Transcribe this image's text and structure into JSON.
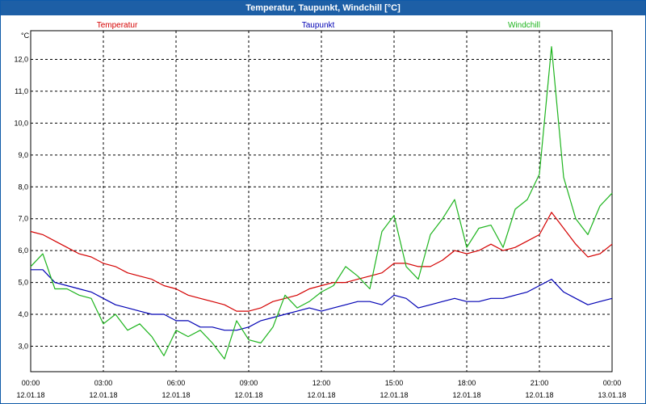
{
  "window": {
    "title": "Temperatur, Taupunkt, Windchill [°C]"
  },
  "chart_data": {
    "type": "line",
    "title": "Temperatur, Taupunkt, Windchill [°C]",
    "ylabel": "°C",
    "ylim": [
      2.2,
      12.9
    ],
    "xlim": [
      "2018-01-12 00:00",
      "2018-01-13 00:00"
    ],
    "yticks": [
      "3,0",
      "4,0",
      "5,0",
      "6,0",
      "7,0",
      "8,0",
      "9,0",
      "10,0",
      "11,0",
      "12,0"
    ],
    "xticks": [
      {
        "time": "00:00",
        "date": "12.01.18"
      },
      {
        "time": "03:00",
        "date": "12.01.18"
      },
      {
        "time": "06:00",
        "date": "12.01.18"
      },
      {
        "time": "09:00",
        "date": "12.01.18"
      },
      {
        "time": "12:00",
        "date": "12.01.18"
      },
      {
        "time": "15:00",
        "date": "12.01.18"
      },
      {
        "time": "18:00",
        "date": "12.01.18"
      },
      {
        "time": "21:00",
        "date": "12.01.18"
      },
      {
        "time": "00:00",
        "date": "13.01.18"
      }
    ],
    "grid": true,
    "legend_placement": "top",
    "series": [
      {
        "name": "Temperatur",
        "color": "#d40000",
        "points": [
          [
            "2018-01-12 00:00",
            6.6
          ],
          [
            "2018-01-12 00:30",
            6.5
          ],
          [
            "2018-01-12 01:00",
            6.3
          ],
          [
            "2018-01-12 01:30",
            6.1
          ],
          [
            "2018-01-12 02:00",
            5.9
          ],
          [
            "2018-01-12 02:30",
            5.8
          ],
          [
            "2018-01-12 03:00",
            5.6
          ],
          [
            "2018-01-12 03:30",
            5.5
          ],
          [
            "2018-01-12 04:00",
            5.3
          ],
          [
            "2018-01-12 04:30",
            5.2
          ],
          [
            "2018-01-12 05:00",
            5.1
          ],
          [
            "2018-01-12 05:30",
            4.9
          ],
          [
            "2018-01-12 06:00",
            4.8
          ],
          [
            "2018-01-12 06:30",
            4.6
          ],
          [
            "2018-01-12 07:00",
            4.5
          ],
          [
            "2018-01-12 07:30",
            4.4
          ],
          [
            "2018-01-12 08:00",
            4.3
          ],
          [
            "2018-01-12 08:30",
            4.1
          ],
          [
            "2018-01-12 09:00",
            4.1
          ],
          [
            "2018-01-12 09:30",
            4.2
          ],
          [
            "2018-01-12 10:00",
            4.4
          ],
          [
            "2018-01-12 10:30",
            4.5
          ],
          [
            "2018-01-12 11:00",
            4.6
          ],
          [
            "2018-01-12 11:30",
            4.8
          ],
          [
            "2018-01-12 12:00",
            4.9
          ],
          [
            "2018-01-12 12:30",
            5.0
          ],
          [
            "2018-01-12 13:00",
            5.0
          ],
          [
            "2018-01-12 13:30",
            5.1
          ],
          [
            "2018-01-12 14:00",
            5.2
          ],
          [
            "2018-01-12 14:30",
            5.3
          ],
          [
            "2018-01-12 15:00",
            5.6
          ],
          [
            "2018-01-12 15:30",
            5.6
          ],
          [
            "2018-01-12 16:00",
            5.5
          ],
          [
            "2018-01-12 16:30",
            5.5
          ],
          [
            "2018-01-12 17:00",
            5.7
          ],
          [
            "2018-01-12 17:30",
            6.0
          ],
          [
            "2018-01-12 18:00",
            5.9
          ],
          [
            "2018-01-12 18:30",
            6.0
          ],
          [
            "2018-01-12 19:00",
            6.2
          ],
          [
            "2018-01-12 19:30",
            6.0
          ],
          [
            "2018-01-12 20:00",
            6.1
          ],
          [
            "2018-01-12 20:30",
            6.3
          ],
          [
            "2018-01-12 21:00",
            6.5
          ],
          [
            "2018-01-12 21:30",
            7.2
          ],
          [
            "2018-01-12 22:00",
            6.7
          ],
          [
            "2018-01-12 22:30",
            6.2
          ],
          [
            "2018-01-12 23:00",
            5.8
          ],
          [
            "2018-01-12 23:30",
            5.9
          ],
          [
            "2018-01-13 00:00",
            6.2
          ]
        ]
      },
      {
        "name": "Taupunkt",
        "color": "#0000b4",
        "points": [
          [
            "2018-01-12 00:00",
            5.4
          ],
          [
            "2018-01-12 00:30",
            5.4
          ],
          [
            "2018-01-12 01:00",
            5.0
          ],
          [
            "2018-01-12 01:30",
            4.9
          ],
          [
            "2018-01-12 02:00",
            4.8
          ],
          [
            "2018-01-12 02:30",
            4.7
          ],
          [
            "2018-01-12 03:00",
            4.5
          ],
          [
            "2018-01-12 03:30",
            4.3
          ],
          [
            "2018-01-12 04:00",
            4.2
          ],
          [
            "2018-01-12 04:30",
            4.1
          ],
          [
            "2018-01-12 05:00",
            4.0
          ],
          [
            "2018-01-12 05:30",
            4.0
          ],
          [
            "2018-01-12 06:00",
            3.8
          ],
          [
            "2018-01-12 06:30",
            3.8
          ],
          [
            "2018-01-12 07:00",
            3.6
          ],
          [
            "2018-01-12 07:30",
            3.6
          ],
          [
            "2018-01-12 08:00",
            3.5
          ],
          [
            "2018-01-12 08:30",
            3.5
          ],
          [
            "2018-01-12 09:00",
            3.6
          ],
          [
            "2018-01-12 09:30",
            3.8
          ],
          [
            "2018-01-12 10:00",
            3.9
          ],
          [
            "2018-01-12 10:30",
            4.0
          ],
          [
            "2018-01-12 11:00",
            4.1
          ],
          [
            "2018-01-12 11:30",
            4.2
          ],
          [
            "2018-01-12 12:00",
            4.1
          ],
          [
            "2018-01-12 12:30",
            4.2
          ],
          [
            "2018-01-12 13:00",
            4.3
          ],
          [
            "2018-01-12 13:30",
            4.4
          ],
          [
            "2018-01-12 14:00",
            4.4
          ],
          [
            "2018-01-12 14:30",
            4.3
          ],
          [
            "2018-01-12 15:00",
            4.6
          ],
          [
            "2018-01-12 15:30",
            4.5
          ],
          [
            "2018-01-12 16:00",
            4.2
          ],
          [
            "2018-01-12 16:30",
            4.3
          ],
          [
            "2018-01-12 17:00",
            4.4
          ],
          [
            "2018-01-12 17:30",
            4.5
          ],
          [
            "2018-01-12 18:00",
            4.4
          ],
          [
            "2018-01-12 18:30",
            4.4
          ],
          [
            "2018-01-12 19:00",
            4.5
          ],
          [
            "2018-01-12 19:30",
            4.5
          ],
          [
            "2018-01-12 20:00",
            4.6
          ],
          [
            "2018-01-12 20:30",
            4.7
          ],
          [
            "2018-01-12 21:00",
            4.9
          ],
          [
            "2018-01-12 21:30",
            5.1
          ],
          [
            "2018-01-12 22:00",
            4.7
          ],
          [
            "2018-01-12 22:30",
            4.5
          ],
          [
            "2018-01-12 23:00",
            4.3
          ],
          [
            "2018-01-12 23:30",
            4.4
          ],
          [
            "2018-01-13 00:00",
            4.5
          ]
        ]
      },
      {
        "name": "Windchill",
        "color": "#1eb41e",
        "points": [
          [
            "2018-01-12 00:00",
            5.5
          ],
          [
            "2018-01-12 00:30",
            5.9
          ],
          [
            "2018-01-12 01:00",
            4.8
          ],
          [
            "2018-01-12 01:30",
            4.8
          ],
          [
            "2018-01-12 02:00",
            4.6
          ],
          [
            "2018-01-12 02:30",
            4.5
          ],
          [
            "2018-01-12 03:00",
            3.7
          ],
          [
            "2018-01-12 03:30",
            4.0
          ],
          [
            "2018-01-12 04:00",
            3.5
          ],
          [
            "2018-01-12 04:30",
            3.7
          ],
          [
            "2018-01-12 05:00",
            3.3
          ],
          [
            "2018-01-12 05:30",
            2.7
          ],
          [
            "2018-01-12 06:00",
            3.5
          ],
          [
            "2018-01-12 06:30",
            3.3
          ],
          [
            "2018-01-12 07:00",
            3.5
          ],
          [
            "2018-01-12 07:30",
            3.1
          ],
          [
            "2018-01-12 08:00",
            2.6
          ],
          [
            "2018-01-12 08:30",
            3.8
          ],
          [
            "2018-01-12 09:00",
            3.2
          ],
          [
            "2018-01-12 09:30",
            3.1
          ],
          [
            "2018-01-12 10:00",
            3.6
          ],
          [
            "2018-01-12 10:30",
            4.6
          ],
          [
            "2018-01-12 11:00",
            4.2
          ],
          [
            "2018-01-12 11:30",
            4.4
          ],
          [
            "2018-01-12 12:00",
            4.7
          ],
          [
            "2018-01-12 12:30",
            4.9
          ],
          [
            "2018-01-12 13:00",
            5.5
          ],
          [
            "2018-01-12 13:30",
            5.2
          ],
          [
            "2018-01-12 14:00",
            4.8
          ],
          [
            "2018-01-12 14:30",
            6.6
          ],
          [
            "2018-01-12 15:00",
            7.1
          ],
          [
            "2018-01-12 15:30",
            5.5
          ],
          [
            "2018-01-12 16:00",
            5.1
          ],
          [
            "2018-01-12 16:30",
            6.5
          ],
          [
            "2018-01-12 17:00",
            7.0
          ],
          [
            "2018-01-12 17:30",
            7.6
          ],
          [
            "2018-01-12 18:00",
            6.1
          ],
          [
            "2018-01-12 18:30",
            6.7
          ],
          [
            "2018-01-12 19:00",
            6.8
          ],
          [
            "2018-01-12 19:30",
            6.1
          ],
          [
            "2018-01-12 20:00",
            7.3
          ],
          [
            "2018-01-12 20:30",
            7.6
          ],
          [
            "2018-01-12 21:00",
            8.4
          ],
          [
            "2018-01-12 21:30",
            12.4
          ],
          [
            "2018-01-12 22:00",
            8.3
          ],
          [
            "2018-01-12 22:30",
            7.0
          ],
          [
            "2018-01-12 23:00",
            6.5
          ],
          [
            "2018-01-12 23:30",
            7.4
          ],
          [
            "2018-01-13 00:00",
            7.8
          ]
        ]
      }
    ]
  }
}
